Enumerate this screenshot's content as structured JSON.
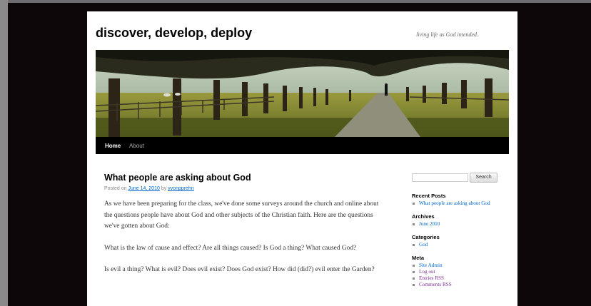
{
  "site": {
    "title": "discover, develop, deploy",
    "description": "living life as God intended."
  },
  "nav": {
    "items": [
      {
        "label": "Home",
        "active": true
      },
      {
        "label": "About",
        "active": false
      }
    ]
  },
  "post": {
    "title": "What people are asking about God",
    "posted_on_prefix": "Posted on",
    "date": "June 14, 2010",
    "by_prefix": "by",
    "author": "yvonpprehn",
    "paragraphs": [
      "As we have been preparing for the class, we've done some surveys around the church and online about the questions people have about God and other subjects of the Christian faith. Here are the questions we've gotten about God:",
      "What is the law of cause and effect?  Are all things caused?  Is God a thing?  What caused God?",
      "Is evil a thing?  What is evil?  Does evil exist?  Does God exist?  How did (did?) evil enter the Garden?"
    ]
  },
  "sidebar": {
    "search": {
      "placeholder": "",
      "button_label": "Search"
    },
    "recent_posts": {
      "title": "Recent Posts",
      "items": [
        "What people are asking about God"
      ]
    },
    "archives": {
      "title": "Archives",
      "items": [
        "June 2010"
      ]
    },
    "categories": {
      "title": "Categories",
      "items": [
        "God"
      ]
    },
    "meta": {
      "title": "Meta",
      "items": [
        "Site Admin",
        "Log out",
        "Entries RSS",
        "Comments RSS"
      ]
    }
  },
  "colors": {
    "link": "#0066cc",
    "visited": "#7a2a8f",
    "nav_background": "#000000",
    "outer_background": "#0e0709"
  },
  "header_image": {
    "icon": "tree-lined-avenue-photo"
  }
}
